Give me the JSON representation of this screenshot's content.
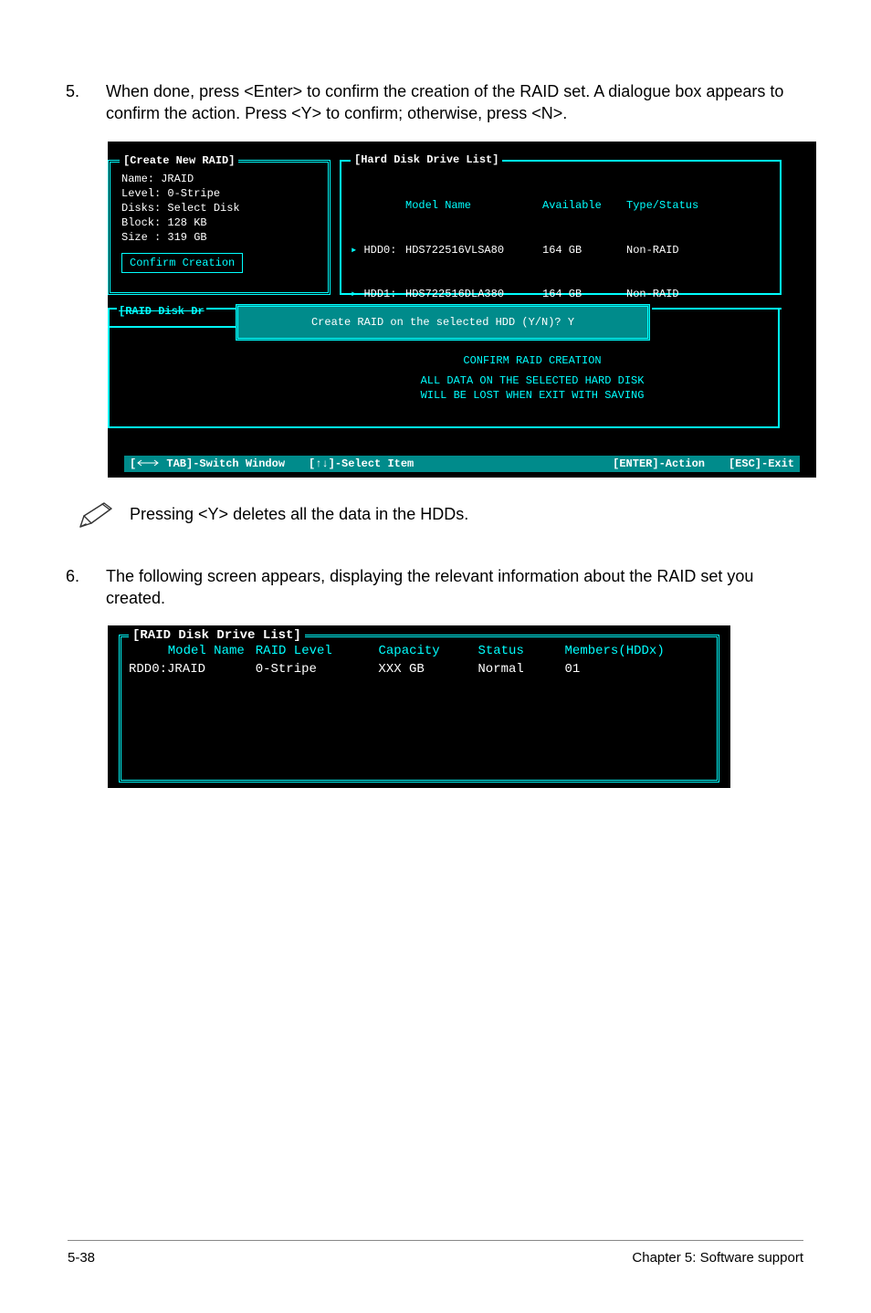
{
  "step5": {
    "num": "5.",
    "text": "When done, press <Enter> to confirm the creation of the RAID set. A dialogue box appears to confirm the action. Press <Y> to confirm; otherwise, press <N>."
  },
  "screenshot1": {
    "create": {
      "title": "[Create New RAID]",
      "lines": {
        "name": "Name:  JRAID",
        "level": "Level: 0-Stripe",
        "disks": "Disks: Select Disk",
        "block": "Block: 128 KB",
        "size": "Size : 319 GB"
      },
      "confirm": "Confirm Creation"
    },
    "hdd": {
      "title": "[Hard Disk Drive List]",
      "header": {
        "model": "Model Name",
        "avail": "Available",
        "type": "Type/Status"
      },
      "rows": [
        {
          "dev": "HDD0:",
          "model": "HDS722516VLSA80",
          "avail": "164 GB",
          "type": "Non-RAID"
        },
        {
          "dev": "HDD1:",
          "model": "HDS722516DLA380",
          "avail": "164 GB",
          "type": "Non-RAID"
        }
      ]
    },
    "raiddr_title": "[RAID Disk Dr",
    "dialog": "Create RAID on the selected HDD (Y/N)? Y",
    "warn": {
      "l1": "CONFIRM RAID CREATION",
      "l2": "ALL DATA ON THE SELECTED HARD DISK",
      "l3": "WILL BE LOST WHEN EXIT WITH SAVING"
    },
    "footer": {
      "tab": "TAB]-Switch Window",
      "sel": "[↑↓]-Select Item",
      "act": "[ENTER]-Action",
      "esc": "[ESC]-Exit",
      "bracket": "["
    }
  },
  "note": "Pressing <Y> deletes all the data in the HDDs.",
  "step6": {
    "num": "6.",
    "text": "The following screen appears, displaying the relevant information about the RAID set you created."
  },
  "screenshot2": {
    "title": "[RAID Disk Drive List]",
    "header": {
      "c1": "Model Name",
      "c2": "RAID Level",
      "c3": "Capacity",
      "c4": "Status",
      "c5": "Members(HDDx)"
    },
    "row": {
      "c1": "RDD0:JRAID",
      "c2": "0-Stripe",
      "c3": "XXX GB",
      "c4": "Normal",
      "c5": "01"
    }
  },
  "page_footer": {
    "left": "5-38",
    "right": "Chapter 5: Software support"
  }
}
